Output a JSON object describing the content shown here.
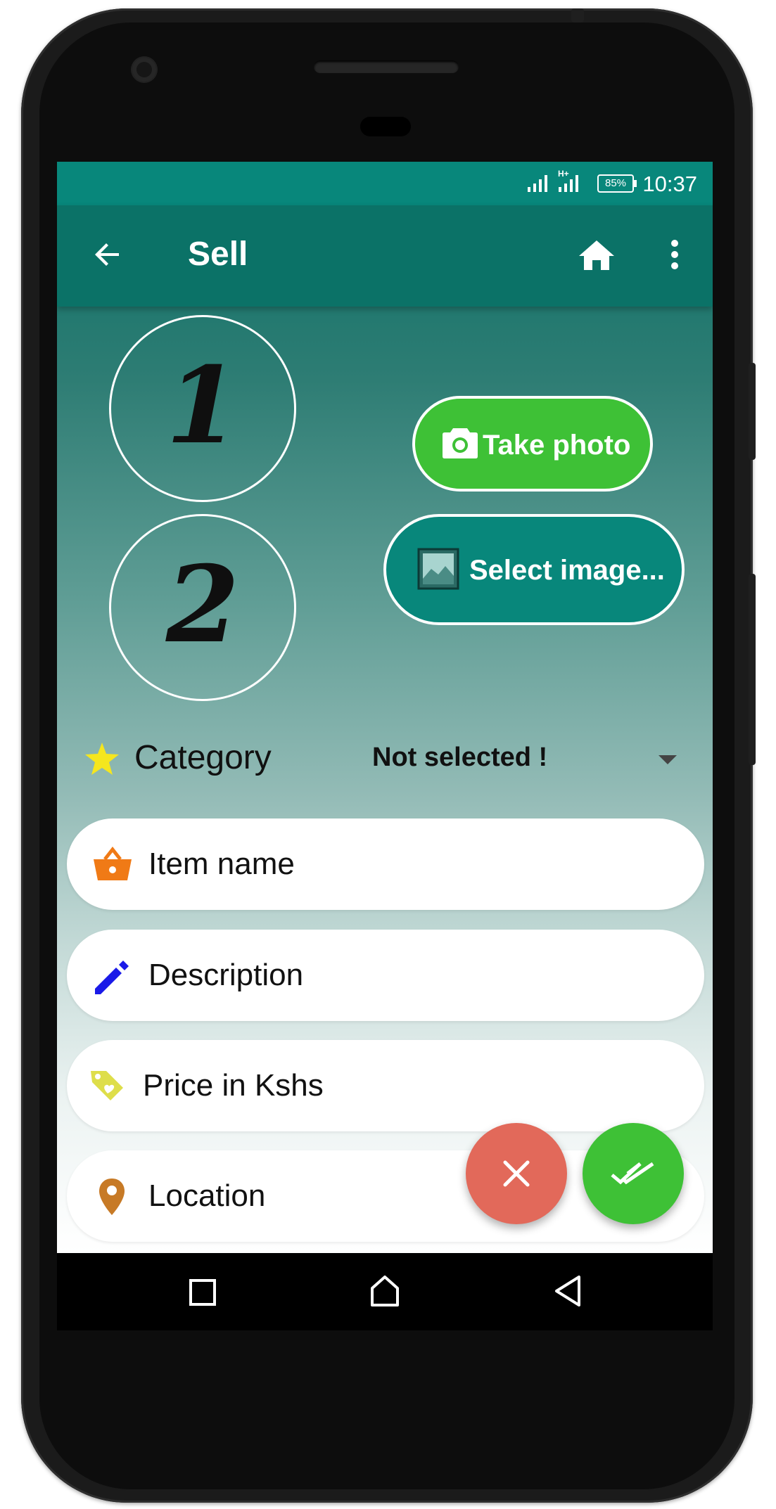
{
  "status_bar": {
    "network": "H+",
    "battery": "85%",
    "time": "10:37"
  },
  "toolbar": {
    "title": "Sell"
  },
  "photos": [
    {
      "label": "1"
    },
    {
      "label": "2"
    }
  ],
  "actions": {
    "take_photo": "Take photo",
    "select_image": "Select image..."
  },
  "category": {
    "label": "Category",
    "value": "Not selected !"
  },
  "fields": {
    "item_name": "Item name",
    "description": "Description",
    "price": "Price in Kshs",
    "location": "Location"
  },
  "colors": {
    "primary": "#0b7267",
    "status_bar": "#08877b",
    "accent_green": "#3ec136",
    "cancel_red": "#e2695a",
    "star_yellow": "#f5e61e",
    "basket_orange": "#f07a16",
    "pencil_blue": "#1a1ae8",
    "tag_yellow": "#dede4a",
    "pin_brown": "#c77a26"
  },
  "icons": {
    "back": "arrow-left-icon",
    "home": "home-icon",
    "menu": "more-vert-icon",
    "camera": "camera-icon",
    "image": "image-icon",
    "star": "star-icon",
    "basket": "basket-icon",
    "pencil": "pencil-icon",
    "tag": "price-tag-icon",
    "pin": "location-pin-icon",
    "close": "close-icon",
    "done": "done-all-icon",
    "recents": "square-nav-icon",
    "nav_home": "home-nav-icon",
    "nav_back": "triangle-back-icon"
  }
}
